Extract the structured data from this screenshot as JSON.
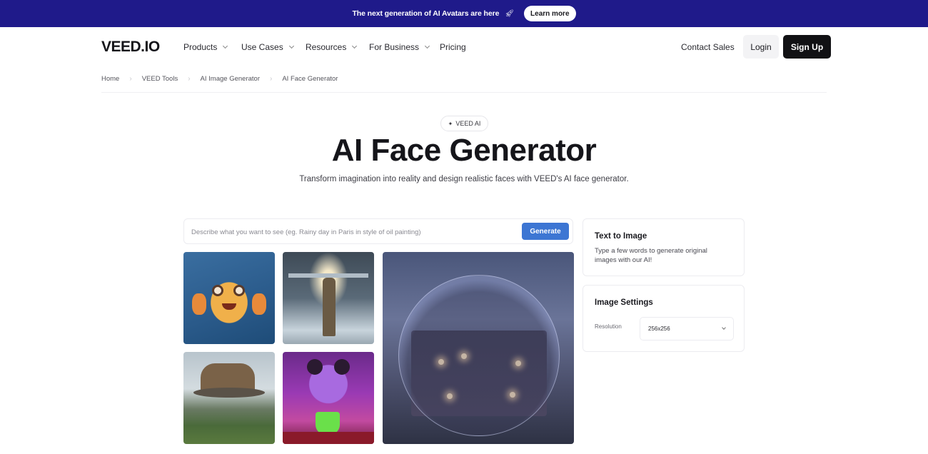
{
  "promo": {
    "text": "The next generation of AI Avatars are here",
    "icon": "rocket-icon",
    "button": "Learn more",
    "background": "#1f1a8a"
  },
  "nav": {
    "logo": "VEED.IO",
    "items": [
      {
        "label": "Products",
        "dropdown": true
      },
      {
        "label": "Use Cases",
        "dropdown": true
      },
      {
        "label": "Resources",
        "dropdown": true
      },
      {
        "label": "For Business",
        "dropdown": true
      },
      {
        "label": "Pricing",
        "dropdown": false
      }
    ],
    "contact_sales": "Contact Sales",
    "login": "Login",
    "signup": "Sign Up"
  },
  "breadcrumb": [
    "Home",
    "VEED Tools",
    "AI Image Generator",
    "AI Face Generator"
  ],
  "hero": {
    "badge": "VEED AI",
    "badge_icon": "sparkle-icon",
    "title": "AI Face Generator",
    "subtitle": "Transform imagination into reality and design realistic faces with VEED's AI face generator."
  },
  "prompt": {
    "placeholder": "Describe what you want to see (eg. Rainy day in Paris in style of oil painting)",
    "value": "",
    "generate_button": "Generate",
    "accent": "#3d76d3"
  },
  "gallery": [
    {
      "name": "cartoon-fish-image"
    },
    {
      "name": "winged-knight-image"
    },
    {
      "name": "house-in-bubble-image"
    },
    {
      "name": "floating-house-image"
    },
    {
      "name": "panda-scientist-image"
    }
  ],
  "text_to_image": {
    "title": "Text to Image",
    "description": "Type a few words to generate original images with our AI!"
  },
  "settings": {
    "title": "Image Settings",
    "resolution_label": "Resolution",
    "resolution_value": "256x256"
  }
}
